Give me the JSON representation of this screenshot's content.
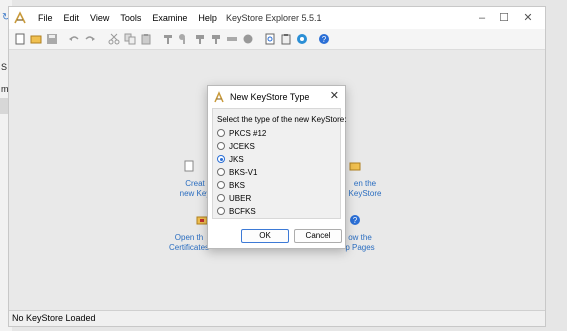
{
  "window": {
    "title": "KeyStore Explorer 5.5.1"
  },
  "menu": [
    "File",
    "Edit",
    "View",
    "Tools",
    "Examine",
    "Help"
  ],
  "toolbar_icons": [
    "new-icon",
    "open-icon",
    "save-icon",
    "undo-icon",
    "redo-icon",
    "cut-icon",
    "copy-icon",
    "paste-icon",
    "generate-keypair-icon",
    "generate-secret-key-icon",
    "import-trusted-cert-icon",
    "import-keypair-icon",
    "set-password-icon",
    "properties-icon",
    "examine-file-icon",
    "examine-clipboard-icon",
    "examine-ssl-icon",
    "help-icon"
  ],
  "quick_start": {
    "create_line1": "Creat",
    "create_line2": "new Key",
    "open_right_line1": "en the",
    "open_right_line2": "KeyStore",
    "open_line1": "Open th",
    "open_line2": "Certificates",
    "help_line1": "ow the",
    "help_line2": "p Pages"
  },
  "behind_window": {
    "a": "S",
    "b": "m"
  },
  "dialog": {
    "title": "New KeyStore Type",
    "prompt": "Select the type of the new KeyStore:",
    "options": [
      {
        "label": "PKCS #12",
        "selected": false
      },
      {
        "label": "JCEKS",
        "selected": false
      },
      {
        "label": "JKS",
        "selected": true
      },
      {
        "label": "BKS-V1",
        "selected": false
      },
      {
        "label": "BKS",
        "selected": false
      },
      {
        "label": "UBER",
        "selected": false
      },
      {
        "label": "BCFKS",
        "selected": false
      }
    ],
    "ok_label": "OK",
    "cancel_label": "Cancel"
  },
  "status": {
    "text": "No KeyStore Loaded"
  },
  "colors": {
    "accent": "#2b6fd6",
    "link": "#2a6dc0"
  }
}
